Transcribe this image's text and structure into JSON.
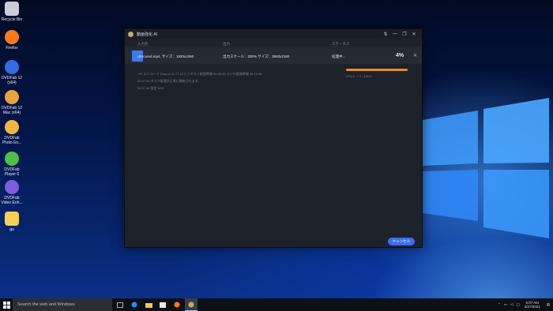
{
  "desktop": {
    "icons": [
      {
        "label": "Recycle Bin",
        "icon": "recycle-bin-icon",
        "color": "#c9ced8"
      },
      {
        "label": "Firefox",
        "icon": "firefox-icon",
        "color": "#ff7a18"
      },
      {
        "label": "DVDFab 12 (x64)",
        "icon": "dvdfab-icon",
        "color": "#2f6de0"
      },
      {
        "label": "DVDFab 12 Mac (x64)",
        "icon": "dvdfab-mac-icon",
        "color": "#e8a33a"
      },
      {
        "label": "DVDFab Photo En...",
        "icon": "dvdfab-photo-icon",
        "color": "#f2b640"
      },
      {
        "label": "DVDFab Player 6",
        "icon": "dvdfab-player-icon",
        "color": "#4fbf4a"
      },
      {
        "label": "DVDFab Video Enh...",
        "icon": "dvdfab-video-icon",
        "color": "#7c5ce0"
      },
      {
        "label": "gu",
        "icon": "folder-icon",
        "color": "#f3cf55"
      }
    ]
  },
  "app": {
    "title": "動画強化 AI",
    "controls": [
      "⇅",
      "—",
      "❐",
      "✕"
    ],
    "columns": {
      "input": "入力元",
      "output": "出力",
      "status": "ステータス"
    },
    "task": {
      "file": "obscured.mp4, サイズ：1920x1080",
      "output": "出力スケール：200% サイズ：3840x2160",
      "status": "処理中...",
      "percent": "4%",
      "close": "✕"
    },
    "log_lines": [
      "-PK エンコード Pass 4.04  77 10 ビジネスト経過時間 26:00:05  スジの経過時間 00:15:28",
      "01:07:44  タスク処理が正常に開始されます。",
      "01:07:44  設定 5:52"
    ],
    "progress": {
      "value": 1.0,
      "color": "#e88a2a"
    },
    "cpu_label": "CPUレート: 100%",
    "cancel_label": "キャンセル"
  },
  "taskbar": {
    "search_placeholder": "Search the web and Windows",
    "apps": [
      "task-view-icon",
      "edge-icon",
      "explorer-icon",
      "store-icon",
      "firefox-icon",
      "dvdfab-icon"
    ],
    "clock_time": "5:07 AM",
    "clock_date": "3/27/2021"
  }
}
